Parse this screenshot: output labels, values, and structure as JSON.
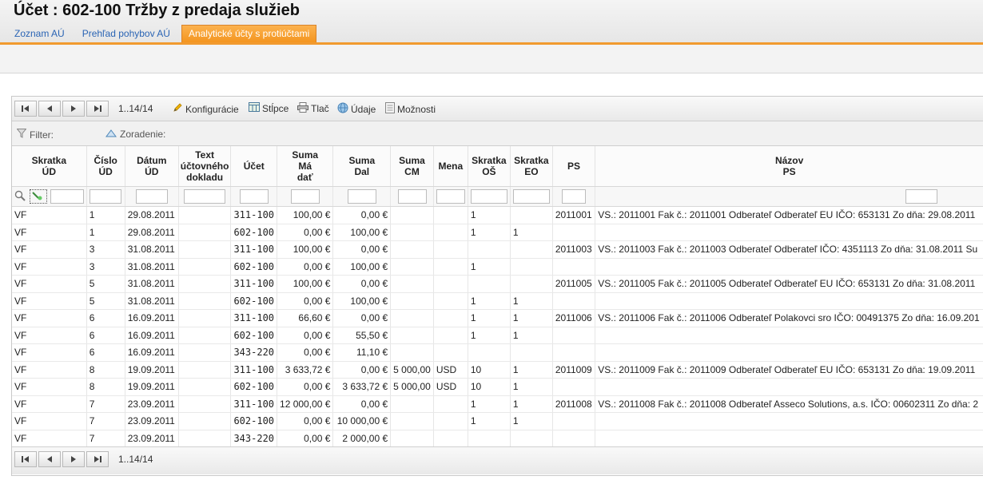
{
  "header": {
    "title": "Účet :  602-100 Tržby z predaja služieb",
    "tabs": [
      {
        "label": "Zoznam AÚ",
        "active": false
      },
      {
        "label": "Prehľad pohybov AÚ",
        "active": false
      },
      {
        "label": "Analytické účty s protiúčtami",
        "active": true
      }
    ]
  },
  "toolbar": {
    "pager_info": "1..14/14",
    "konfiguracie": "Konfigurácie",
    "stlpce": "Stĺpce",
    "tlac": "Tlač",
    "udaje": "Údaje",
    "moznosti": "Možnosti"
  },
  "filterbar": {
    "filter_label": "Filter:",
    "sort_label": "Zoradenie:"
  },
  "columns": [
    {
      "key": "skratka_ud",
      "label_lines": [
        "Skratka",
        "ÚD"
      ]
    },
    {
      "key": "cislo_ud",
      "label_lines": [
        "Číslo",
        "ÚD"
      ]
    },
    {
      "key": "datum_ud",
      "label_lines": [
        "Dátum",
        "ÚD"
      ]
    },
    {
      "key": "text_ud",
      "label_lines": [
        "Text",
        "účtovného",
        "dokladu"
      ]
    },
    {
      "key": "ucet",
      "label_lines": [
        "Účet"
      ]
    },
    {
      "key": "suma_md",
      "label_lines": [
        "Suma",
        "Má",
        "dať"
      ]
    },
    {
      "key": "suma_dal",
      "label_lines": [
        "Suma",
        "Dal"
      ]
    },
    {
      "key": "suma_cm",
      "label_lines": [
        "Suma",
        "CM"
      ]
    },
    {
      "key": "mena",
      "label_lines": [
        "Mena"
      ]
    },
    {
      "key": "skratka_os",
      "label_lines": [
        "Skratka",
        "OŠ"
      ]
    },
    {
      "key": "skratka_eo",
      "label_lines": [
        "Skratka",
        "EO"
      ]
    },
    {
      "key": "ps",
      "label_lines": [
        "PS"
      ]
    },
    {
      "key": "nazov_ps",
      "label_lines": [
        "Názov",
        "PS"
      ]
    }
  ],
  "rows": [
    {
      "skratka_ud": "VF",
      "cislo_ud": "1",
      "datum_ud": "29.08.2011",
      "text_ud": "",
      "ucet": "311-100",
      "suma_md": "100,00 €",
      "suma_dal": "0,00 €",
      "suma_cm": "",
      "mena": "",
      "skratka_os": "1",
      "skratka_eo": "",
      "ps": "2011001",
      "nazov_ps": "VS.: 2011001 Fak č.: 2011001 Odberateľ Odberateľ EU IČO: 653131 Zo dňa: 29.08.2011"
    },
    {
      "skratka_ud": "VF",
      "cislo_ud": "1",
      "datum_ud": "29.08.2011",
      "text_ud": "",
      "ucet": "602-100",
      "suma_md": "0,00 €",
      "suma_dal": "100,00 €",
      "suma_cm": "",
      "mena": "",
      "skratka_os": "1",
      "skratka_eo": "1",
      "ps": "",
      "nazov_ps": ""
    },
    {
      "skratka_ud": "VF",
      "cislo_ud": "3",
      "datum_ud": "31.08.2011",
      "text_ud": "",
      "ucet": "311-100",
      "suma_md": "100,00 €",
      "suma_dal": "0,00 €",
      "suma_cm": "",
      "mena": "",
      "skratka_os": "",
      "skratka_eo": "",
      "ps": "2011003",
      "nazov_ps": "VS.: 2011003 Fak č.: 2011003 Odberateľ Odberateľ IČO: 4351113 Zo dňa: 31.08.2011 Su"
    },
    {
      "skratka_ud": "VF",
      "cislo_ud": "3",
      "datum_ud": "31.08.2011",
      "text_ud": "",
      "ucet": "602-100",
      "suma_md": "0,00 €",
      "suma_dal": "100,00 €",
      "suma_cm": "",
      "mena": "",
      "skratka_os": "1",
      "skratka_eo": "",
      "ps": "",
      "nazov_ps": ""
    },
    {
      "skratka_ud": "VF",
      "cislo_ud": "5",
      "datum_ud": "31.08.2011",
      "text_ud": "",
      "ucet": "311-100",
      "suma_md": "100,00 €",
      "suma_dal": "0,00 €",
      "suma_cm": "",
      "mena": "",
      "skratka_os": "",
      "skratka_eo": "",
      "ps": "2011005",
      "nazov_ps": "VS.: 2011005 Fak č.: 2011005 Odberateľ Odberateľ EU IČO: 653131 Zo dňa: 31.08.2011"
    },
    {
      "skratka_ud": "VF",
      "cislo_ud": "5",
      "datum_ud": "31.08.2011",
      "text_ud": "",
      "ucet": "602-100",
      "suma_md": "0,00 €",
      "suma_dal": "100,00 €",
      "suma_cm": "",
      "mena": "",
      "skratka_os": "1",
      "skratka_eo": "1",
      "ps": "",
      "nazov_ps": ""
    },
    {
      "skratka_ud": "VF",
      "cislo_ud": "6",
      "datum_ud": "16.09.2011",
      "text_ud": "",
      "ucet": "311-100",
      "suma_md": "66,60 €",
      "suma_dal": "0,00 €",
      "suma_cm": "",
      "mena": "",
      "skratka_os": "1",
      "skratka_eo": "1",
      "ps": "2011006",
      "nazov_ps": "VS.: 2011006 Fak č.: 2011006 Odberateľ Polakovci sro IČO: 00491375 Zo dňa: 16.09.201"
    },
    {
      "skratka_ud": "VF",
      "cislo_ud": "6",
      "datum_ud": "16.09.2011",
      "text_ud": "",
      "ucet": "602-100",
      "suma_md": "0,00 €",
      "suma_dal": "55,50 €",
      "suma_cm": "",
      "mena": "",
      "skratka_os": "1",
      "skratka_eo": "1",
      "ps": "",
      "nazov_ps": ""
    },
    {
      "skratka_ud": "VF",
      "cislo_ud": "6",
      "datum_ud": "16.09.2011",
      "text_ud": "",
      "ucet": "343-220",
      "suma_md": "0,00 €",
      "suma_dal": "11,10 €",
      "suma_cm": "",
      "mena": "",
      "skratka_os": "",
      "skratka_eo": "",
      "ps": "",
      "nazov_ps": ""
    },
    {
      "skratka_ud": "VF",
      "cislo_ud": "8",
      "datum_ud": "19.09.2011",
      "text_ud": "",
      "ucet": "311-100",
      "suma_md": "3 633,72 €",
      "suma_dal": "0,00 €",
      "suma_cm": "5 000,00",
      "mena": "USD",
      "skratka_os": "10",
      "skratka_eo": "1",
      "ps": "2011009",
      "nazov_ps": "VS.: 2011009 Fak č.: 2011009 Odberateľ Odberateľ EU IČO: 653131 Zo dňa: 19.09.2011"
    },
    {
      "skratka_ud": "VF",
      "cislo_ud": "8",
      "datum_ud": "19.09.2011",
      "text_ud": "",
      "ucet": "602-100",
      "suma_md": "0,00 €",
      "suma_dal": "3 633,72 €",
      "suma_cm": "5 000,00",
      "mena": "USD",
      "skratka_os": "10",
      "skratka_eo": "1",
      "ps": "",
      "nazov_ps": ""
    },
    {
      "skratka_ud": "VF",
      "cislo_ud": "7",
      "datum_ud": "23.09.2011",
      "text_ud": "",
      "ucet": "311-100",
      "suma_md": "12 000,00 €",
      "suma_dal": "0,00 €",
      "suma_cm": "",
      "mena": "",
      "skratka_os": "1",
      "skratka_eo": "1",
      "ps": "2011008",
      "nazov_ps": "VS.: 2011008 Fak č.: 2011008 Odberateľ Asseco Solutions, a.s. IČO: 00602311 Zo dňa: 2"
    },
    {
      "skratka_ud": "VF",
      "cislo_ud": "7",
      "datum_ud": "23.09.2011",
      "text_ud": "",
      "ucet": "602-100",
      "suma_md": "0,00 €",
      "suma_dal": "10 000,00 €",
      "suma_cm": "",
      "mena": "",
      "skratka_os": "1",
      "skratka_eo": "1",
      "ps": "",
      "nazov_ps": ""
    },
    {
      "skratka_ud": "VF",
      "cislo_ud": "7",
      "datum_ud": "23.09.2011",
      "text_ud": "",
      "ucet": "343-220",
      "suma_md": "0,00 €",
      "suma_dal": "2 000,00 €",
      "suma_cm": "",
      "mena": "",
      "skratka_os": "",
      "skratka_eo": "",
      "ps": "",
      "nazov_ps": ""
    }
  ],
  "bottom": {
    "pager_info": "1..14/14"
  },
  "icons": {
    "first": "first-page-icon",
    "prev": "prev-page-icon",
    "next": "next-page-icon",
    "last": "last-page-icon",
    "konfiguracie": "pencil-icon",
    "stlpce": "columns-icon",
    "tlac": "printer-icon",
    "udaje": "globe-icon",
    "moznosti": "document-icon",
    "filter": "funnel-icon",
    "sort": "triangle-up-icon",
    "search": "magnifier-icon"
  },
  "colors": {
    "tab_active": "#f39520",
    "tab_link": "#2a64b4",
    "accent_line": "#f19a2f"
  }
}
